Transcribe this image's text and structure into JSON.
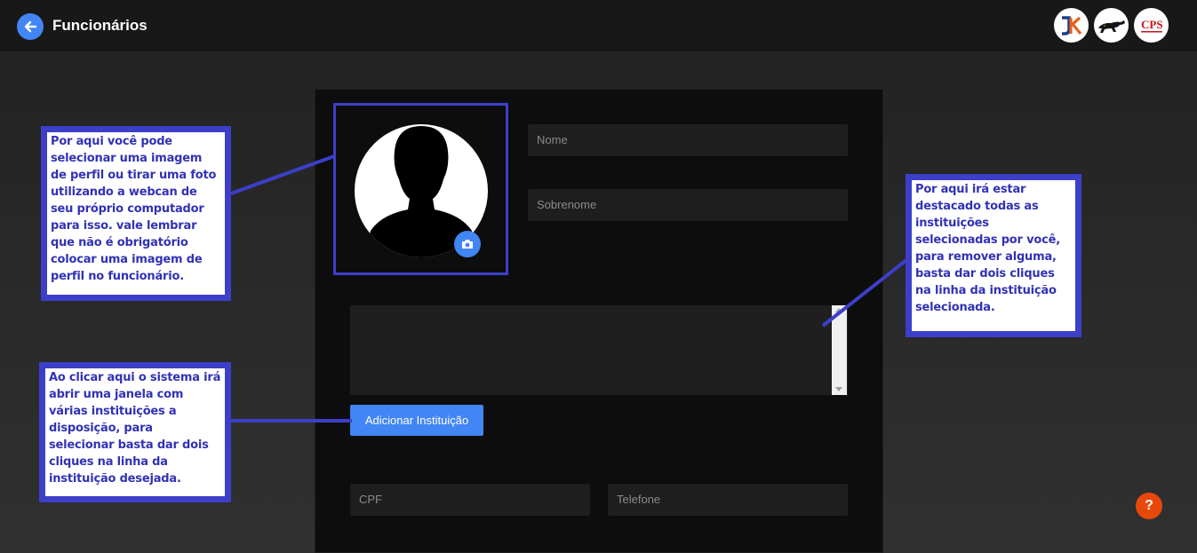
{
  "header": {
    "title": "Funcionários",
    "back_icon": "arrow-left-icon",
    "logos": [
      {
        "name": "jk-logo",
        "text": "JK"
      },
      {
        "name": "jaguar-logo",
        "text": ""
      },
      {
        "name": "cps-logo",
        "text": "CPS"
      }
    ]
  },
  "form": {
    "nome_placeholder": "Nome",
    "sobrenome_placeholder": "Sobrenome",
    "add_institution_label": "Adicionar Instituição",
    "cpf_placeholder": "CPF",
    "telefone_placeholder": "Telefone",
    "camera_icon": "camera-icon"
  },
  "annotations": {
    "photo": "Por aqui você pode selecionar uma imagem de perfil ou tirar uma foto utilizando a webcan de seu próprio computador para isso. vale lembrar que não é obrigatório colocar uma imagem de perfil no funcionário.",
    "add_button": "Ao clicar aqui o sistema irá abrir uma janela com várias instituições a disposição, para selecionar basta dar dois cliques na linha da instituição desejada.",
    "list": "Por aqui irá estar destacado todas as instituições selecionadas por você, para remover alguma, basta dar dois cliques na linha da instituição selecionada."
  },
  "help": {
    "label": "?"
  },
  "colors": {
    "accent": "#4285f4",
    "annotation_border": "#3d3fc9",
    "annotation_text": "#3132b5",
    "help": "#e8480c"
  }
}
